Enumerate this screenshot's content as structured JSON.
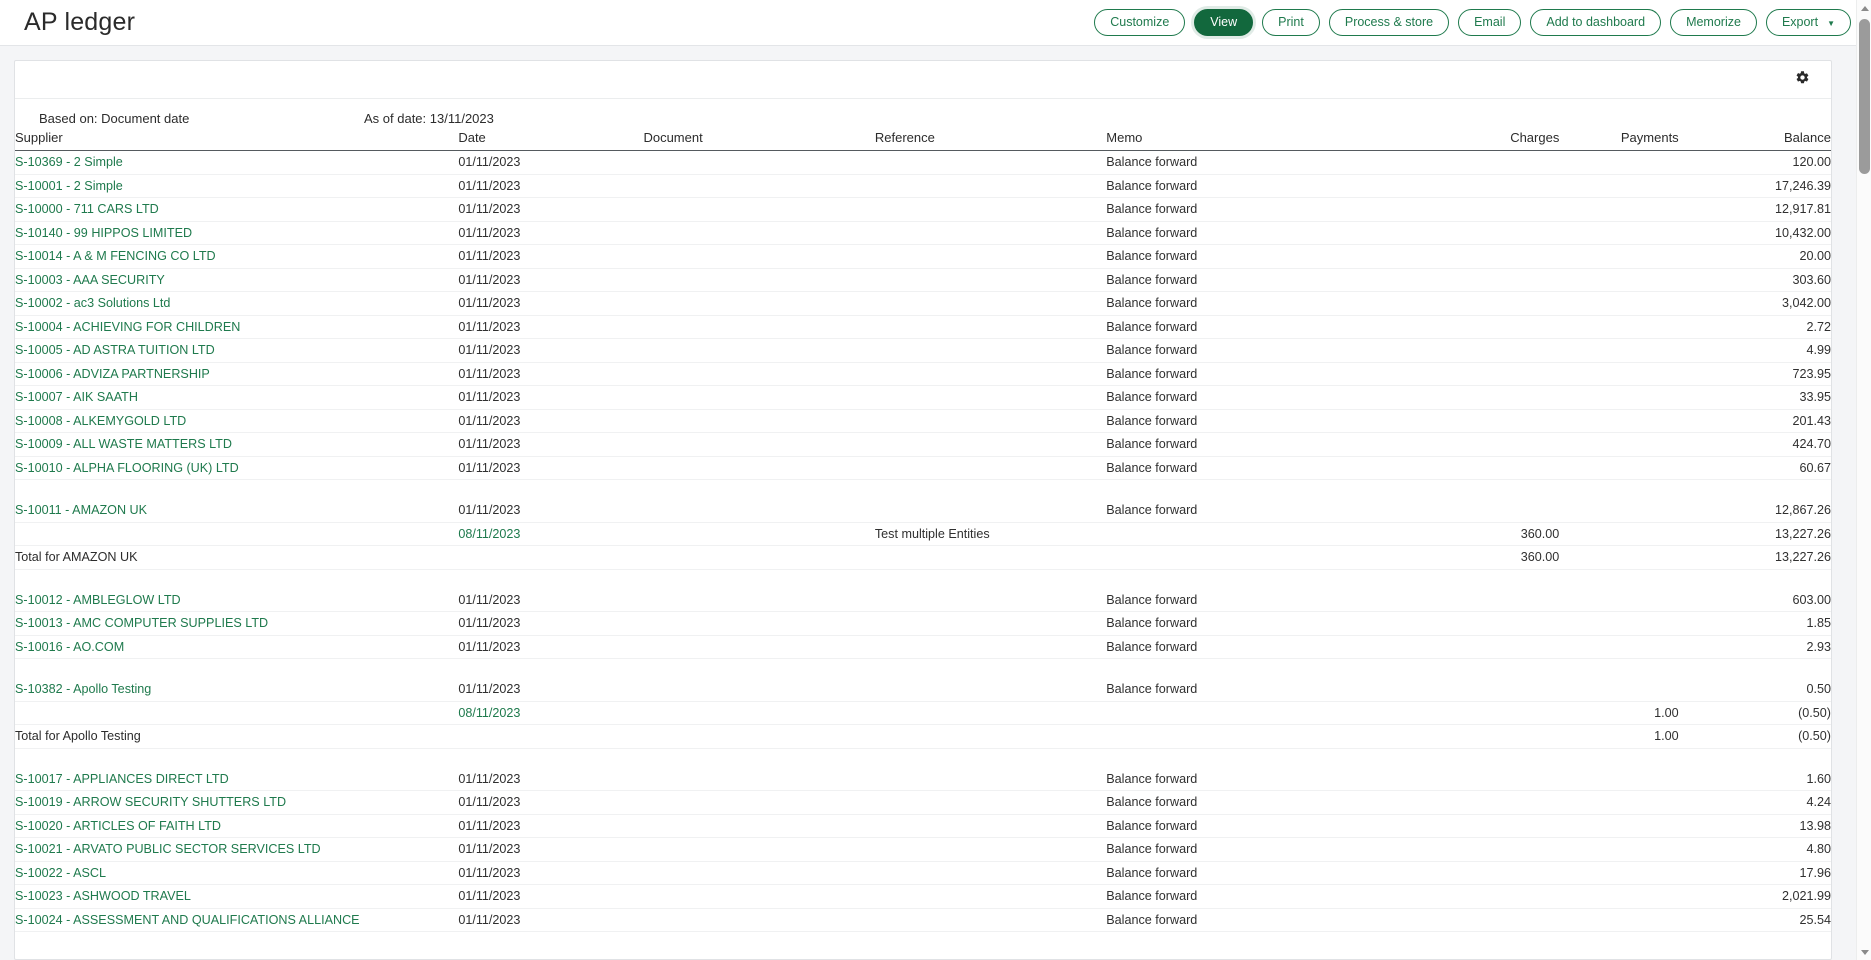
{
  "header": {
    "title": "AP ledger",
    "toolbar": [
      {
        "id": "customize",
        "label": "Customize",
        "primary": false,
        "caret": false
      },
      {
        "id": "view",
        "label": "View",
        "primary": true,
        "caret": false
      },
      {
        "id": "print",
        "label": "Print",
        "primary": false,
        "caret": false
      },
      {
        "id": "process-store",
        "label": "Process & store",
        "primary": false,
        "caret": false
      },
      {
        "id": "email",
        "label": "Email",
        "primary": false,
        "caret": false
      },
      {
        "id": "add-to-dashboard",
        "label": "Add to dashboard",
        "primary": false,
        "caret": false
      },
      {
        "id": "memorize",
        "label": "Memorize",
        "primary": false,
        "caret": false
      },
      {
        "id": "export",
        "label": "Export",
        "primary": false,
        "caret": true
      }
    ],
    "caret_glyph": "▼"
  },
  "report": {
    "settings_icon": "gear-icon",
    "based_on": "Based on: Document date",
    "as_of": "As of date: 13/11/2023",
    "columns": [
      {
        "key": "supplier",
        "label": "Supplier",
        "align": "left"
      },
      {
        "key": "date",
        "label": "Date",
        "align": "left"
      },
      {
        "key": "document",
        "label": "Document",
        "align": "left"
      },
      {
        "key": "reference",
        "label": "Reference",
        "align": "left"
      },
      {
        "key": "memo",
        "label": "Memo",
        "align": "left"
      },
      {
        "key": "charges",
        "label": "Charges",
        "align": "right"
      },
      {
        "key": "payments",
        "label": "Payments",
        "align": "right"
      },
      {
        "key": "balance",
        "label": "Balance",
        "align": "right"
      }
    ],
    "balance_forward_label": "Balance forward",
    "rows": [
      {
        "type": "data",
        "supplier": "S-10369 - 2 Simple",
        "supplier_link": true,
        "date": "01/11/2023",
        "date_link": false,
        "document": "",
        "reference": "",
        "memo": "Balance forward",
        "charges": "",
        "payments": "",
        "balance": "120.00"
      },
      {
        "type": "data",
        "supplier": "S-10001 - 2 Simple",
        "supplier_link": true,
        "date": "01/11/2023",
        "date_link": false,
        "document": "",
        "reference": "",
        "memo": "Balance forward",
        "charges": "",
        "payments": "",
        "balance": "17,246.39"
      },
      {
        "type": "data",
        "supplier": "S-10000 - 711 CARS LTD",
        "supplier_link": true,
        "date": "01/11/2023",
        "date_link": false,
        "document": "",
        "reference": "",
        "memo": "Balance forward",
        "charges": "",
        "payments": "",
        "balance": "12,917.81"
      },
      {
        "type": "data",
        "supplier": "S-10140 - 99 HIPPOS LIMITED",
        "supplier_link": true,
        "date": "01/11/2023",
        "date_link": false,
        "document": "",
        "reference": "",
        "memo": "Balance forward",
        "charges": "",
        "payments": "",
        "balance": "10,432.00"
      },
      {
        "type": "data",
        "supplier": "S-10014 - A & M FENCING CO LTD",
        "supplier_link": true,
        "date": "01/11/2023",
        "date_link": false,
        "document": "",
        "reference": "",
        "memo": "Balance forward",
        "charges": "",
        "payments": "",
        "balance": "20.00"
      },
      {
        "type": "data",
        "supplier": "S-10003 - AAA SECURITY",
        "supplier_link": true,
        "date": "01/11/2023",
        "date_link": false,
        "document": "",
        "reference": "",
        "memo": "Balance forward",
        "charges": "",
        "payments": "",
        "balance": "303.60"
      },
      {
        "type": "data",
        "supplier": "S-10002 - ac3 Solutions Ltd",
        "supplier_link": true,
        "date": "01/11/2023",
        "date_link": false,
        "document": "",
        "reference": "",
        "memo": "Balance forward",
        "charges": "",
        "payments": "",
        "balance": "3,042.00"
      },
      {
        "type": "data",
        "supplier": "S-10004 - ACHIEVING FOR CHILDREN",
        "supplier_link": true,
        "date": "01/11/2023",
        "date_link": false,
        "document": "",
        "reference": "",
        "memo": "Balance forward",
        "charges": "",
        "payments": "",
        "balance": "2.72"
      },
      {
        "type": "data",
        "supplier": "S-10005 - AD ASTRA TUITION LTD",
        "supplier_link": true,
        "date": "01/11/2023",
        "date_link": false,
        "document": "",
        "reference": "",
        "memo": "Balance forward",
        "charges": "",
        "payments": "",
        "balance": "4.99"
      },
      {
        "type": "data",
        "supplier": "S-10006 - ADVIZA PARTNERSHIP",
        "supplier_link": true,
        "date": "01/11/2023",
        "date_link": false,
        "document": "",
        "reference": "",
        "memo": "Balance forward",
        "charges": "",
        "payments": "",
        "balance": "723.95"
      },
      {
        "type": "data",
        "supplier": "S-10007 - AIK SAATH",
        "supplier_link": true,
        "date": "01/11/2023",
        "date_link": false,
        "document": "",
        "reference": "",
        "memo": "Balance forward",
        "charges": "",
        "payments": "",
        "balance": "33.95"
      },
      {
        "type": "data",
        "supplier": "S-10008 - ALKEMYGOLD LTD",
        "supplier_link": true,
        "date": "01/11/2023",
        "date_link": false,
        "document": "",
        "reference": "",
        "memo": "Balance forward",
        "charges": "",
        "payments": "",
        "balance": "201.43"
      },
      {
        "type": "data",
        "supplier": "S-10009 - ALL WASTE MATTERS LTD",
        "supplier_link": true,
        "date": "01/11/2023",
        "date_link": false,
        "document": "",
        "reference": "",
        "memo": "Balance forward",
        "charges": "",
        "payments": "",
        "balance": "424.70"
      },
      {
        "type": "data",
        "supplier": "S-10010 - ALPHA FLOORING (UK) LTD",
        "supplier_link": true,
        "date": "01/11/2023",
        "date_link": false,
        "document": "",
        "reference": "",
        "memo": "Balance forward",
        "charges": "",
        "payments": "",
        "balance": "60.67"
      },
      {
        "type": "spacer"
      },
      {
        "type": "data",
        "supplier": "S-10011 - AMAZON UK",
        "supplier_link": true,
        "date": "01/11/2023",
        "date_link": false,
        "document": "",
        "reference": "",
        "memo": "Balance forward",
        "charges": "",
        "payments": "",
        "balance": "12,867.26"
      },
      {
        "type": "data",
        "supplier": "",
        "supplier_link": false,
        "date": "08/11/2023",
        "date_link": true,
        "document": "",
        "reference": "Test multiple Entities",
        "memo": "",
        "charges": "360.00",
        "payments": "",
        "balance": "13,227.26"
      },
      {
        "type": "total",
        "supplier": "Total for AMAZON UK",
        "date": "",
        "document": "",
        "reference": "",
        "memo": "",
        "charges": "360.00",
        "payments": "",
        "balance": "13,227.26"
      },
      {
        "type": "spacer"
      },
      {
        "type": "data",
        "supplier": "S-10012 - AMBLEGLOW LTD",
        "supplier_link": true,
        "date": "01/11/2023",
        "date_link": false,
        "document": "",
        "reference": "",
        "memo": "Balance forward",
        "charges": "",
        "payments": "",
        "balance": "603.00"
      },
      {
        "type": "data",
        "supplier": "S-10013 - AMC COMPUTER SUPPLIES LTD",
        "supplier_link": true,
        "date": "01/11/2023",
        "date_link": false,
        "document": "",
        "reference": "",
        "memo": "Balance forward",
        "charges": "",
        "payments": "",
        "balance": "1.85"
      },
      {
        "type": "data",
        "supplier": "S-10016 - AO.COM",
        "supplier_link": true,
        "date": "01/11/2023",
        "date_link": false,
        "document": "",
        "reference": "",
        "memo": "Balance forward",
        "charges": "",
        "payments": "",
        "balance": "2.93"
      },
      {
        "type": "spacer"
      },
      {
        "type": "data",
        "supplier": "S-10382 - Apollo Testing",
        "supplier_link": true,
        "date": "01/11/2023",
        "date_link": false,
        "document": "",
        "reference": "",
        "memo": "Balance forward",
        "charges": "",
        "payments": "",
        "balance": "0.50"
      },
      {
        "type": "data",
        "supplier": "",
        "supplier_link": false,
        "date": "08/11/2023",
        "date_link": true,
        "document": "",
        "reference": "",
        "memo": "",
        "charges": "",
        "payments": "1.00",
        "balance": "(0.50)"
      },
      {
        "type": "total",
        "supplier": "Total for Apollo Testing",
        "date": "",
        "document": "",
        "reference": "",
        "memo": "",
        "charges": "",
        "payments": "1.00",
        "balance": "(0.50)",
        "rule_charges": true
      },
      {
        "type": "spacer"
      },
      {
        "type": "data",
        "supplier": "S-10017 - APPLIANCES DIRECT LTD",
        "supplier_link": true,
        "date": "01/11/2023",
        "date_link": false,
        "document": "",
        "reference": "",
        "memo": "Balance forward",
        "charges": "",
        "payments": "",
        "balance": "1.60"
      },
      {
        "type": "data",
        "supplier": "S-10019 - ARROW SECURITY SHUTTERS LTD",
        "supplier_link": true,
        "date": "01/11/2023",
        "date_link": false,
        "document": "",
        "reference": "",
        "memo": "Balance forward",
        "charges": "",
        "payments": "",
        "balance": "4.24"
      },
      {
        "type": "data",
        "supplier": "S-10020 - ARTICLES OF FAITH LTD",
        "supplier_link": true,
        "date": "01/11/2023",
        "date_link": false,
        "document": "",
        "reference": "",
        "memo": "Balance forward",
        "charges": "",
        "payments": "",
        "balance": "13.98"
      },
      {
        "type": "data",
        "supplier": "S-10021 - ARVATO PUBLIC SECTOR SERVICES LTD",
        "supplier_link": true,
        "date": "01/11/2023",
        "date_link": false,
        "document": "",
        "reference": "",
        "memo": "Balance forward",
        "charges": "",
        "payments": "",
        "balance": "4.80"
      },
      {
        "type": "data",
        "supplier": "S-10022 - ASCL",
        "supplier_link": true,
        "date": "01/11/2023",
        "date_link": false,
        "document": "",
        "reference": "",
        "memo": "Balance forward",
        "charges": "",
        "payments": "",
        "balance": "17.96"
      },
      {
        "type": "data",
        "supplier": "S-10023 - ASHWOOD TRAVEL",
        "supplier_link": true,
        "date": "01/11/2023",
        "date_link": false,
        "document": "",
        "reference": "",
        "memo": "Balance forward",
        "charges": "",
        "payments": "",
        "balance": "2,021.99"
      },
      {
        "type": "data",
        "supplier": "S-10024 - ASSESSMENT AND QUALIFICATIONS ALLIANCE",
        "supplier_link": true,
        "date": "01/11/2023",
        "date_link": false,
        "document": "",
        "reference": "",
        "memo": "Balance forward",
        "charges": "",
        "payments": "",
        "balance": "25.54"
      }
    ]
  },
  "scrollbar": {
    "up_arrow": "scroll-up-arrow",
    "down_arrow": "scroll-down-arrow"
  },
  "colors": {
    "brand_green": "#12683d",
    "link_green": "#1f7a4d",
    "page_bg": "#f4f5f7"
  }
}
